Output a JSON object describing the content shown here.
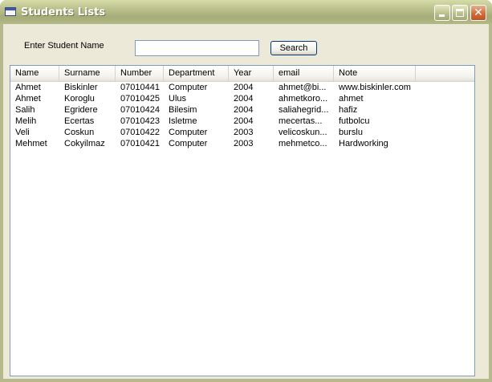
{
  "window": {
    "title": "Students Lists",
    "min_icon": "minimize-icon",
    "max_icon": "maximize-icon",
    "close_icon": "close-icon",
    "close_glyph": "✕"
  },
  "search": {
    "label": "Enter Student Name",
    "value": "",
    "placeholder": "",
    "button_label": "Search"
  },
  "table": {
    "columns": [
      "Name",
      "Surname",
      "Number",
      "Department",
      "Year",
      "email",
      "Note"
    ],
    "rows": [
      [
        "Ahmet",
        "Biskinler",
        "07010441",
        "Computer",
        "2004",
        "ahmet@bi...",
        "www.biskinler.com"
      ],
      [
        "Ahmet",
        "Koroglu",
        "07010425",
        "Ulus",
        "2004",
        "ahmetkoro...",
        "ahmet"
      ],
      [
        "Salih",
        "Egridere",
        "07010424",
        "Bilesim",
        "2004",
        "saliahegrid...",
        "hafiz"
      ],
      [
        "Melih",
        "Ecertas",
        "07010423",
        "Isletme",
        "2004",
        "mecertas...",
        "futbolcu"
      ],
      [
        "Veli",
        "Coskun",
        "07010422",
        "Computer",
        "2003",
        "velicoskun...",
        "burslu"
      ],
      [
        "Mehmet",
        "Cokyilmaz",
        "07010421",
        "Computer",
        "2003",
        "mehmetco...",
        "Hardworking"
      ]
    ]
  },
  "colors": {
    "titlebar": "#B5B98C",
    "client_bg": "#ECE9D8",
    "close_button": "#D36B3C"
  }
}
